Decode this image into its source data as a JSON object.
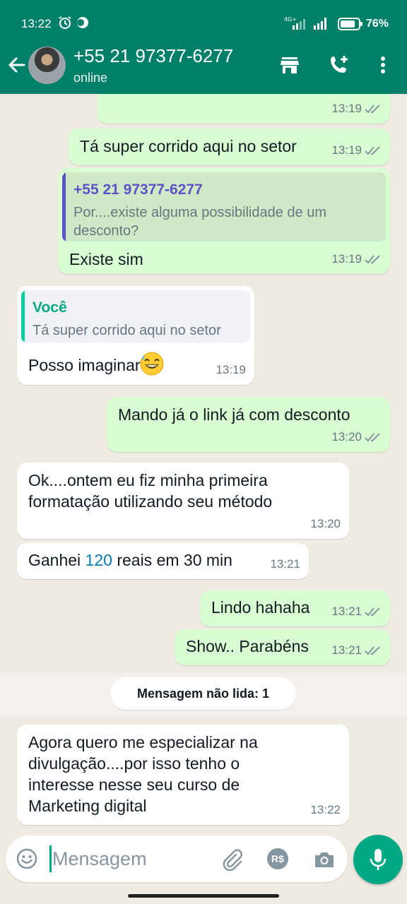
{
  "status_bar": {
    "time": "13:22",
    "network": "4G+",
    "battery": "76%"
  },
  "header": {
    "contact_name": "+55 21 97377-6277",
    "contact_status": "online",
    "icons": [
      "back-arrow-icon",
      "store-icon",
      "add-call-icon",
      "more-vert-icon"
    ]
  },
  "messages": [
    {
      "dir": "out",
      "text": "",
      "time": "13:19"
    },
    {
      "dir": "out",
      "text": "Tá super corrido aqui no setor",
      "time": "13:19"
    },
    {
      "dir": "out",
      "quote_name": "+55 21 97377-6277",
      "quote_text": "Por....existe alguma possibilidade de um\ndesconto?",
      "text": "Existe sim",
      "time": "13:19"
    },
    {
      "dir": "in",
      "quote_name": "Você",
      "quote_text": "Tá super corrido aqui no setor",
      "text": "Posso imaginar",
      "time": "13:19"
    },
    {
      "dir": "out",
      "text": "Mando já o link já com desconto",
      "time": "13:20"
    },
    {
      "dir": "in",
      "text": "Ok....ontem eu fiz minha primeira\nformatação utilizando seu método",
      "time": "13:20"
    },
    {
      "dir": "in",
      "text_before": "Ganhei ",
      "text_number": "120",
      "text_after": " reais em 30 min",
      "time": "13:21"
    },
    {
      "dir": "out",
      "text": "Lindo hahaha",
      "time": "13:21"
    },
    {
      "dir": "out",
      "text": "Show.. Parabéns",
      "time": "13:21"
    },
    {
      "dir": "in",
      "text": "Agora quero me especializar na\ndivulgação....por isso tenho o\ninteresse nesse seu curso de\nMarketing digital",
      "time": "13:22"
    }
  ],
  "unread_divider": "Mensagem não lida: 1",
  "composer": {
    "placeholder": "Mensagem",
    "pix_label": "R$"
  },
  "colors": {
    "header": "#008069",
    "outgoing_bubble": "#d9fdd3",
    "incoming_bubble": "#ffffff",
    "accent": "#00a884",
    "quote_out_bar": "#5e53c6",
    "quote_in_bar": "#06cf9c"
  }
}
